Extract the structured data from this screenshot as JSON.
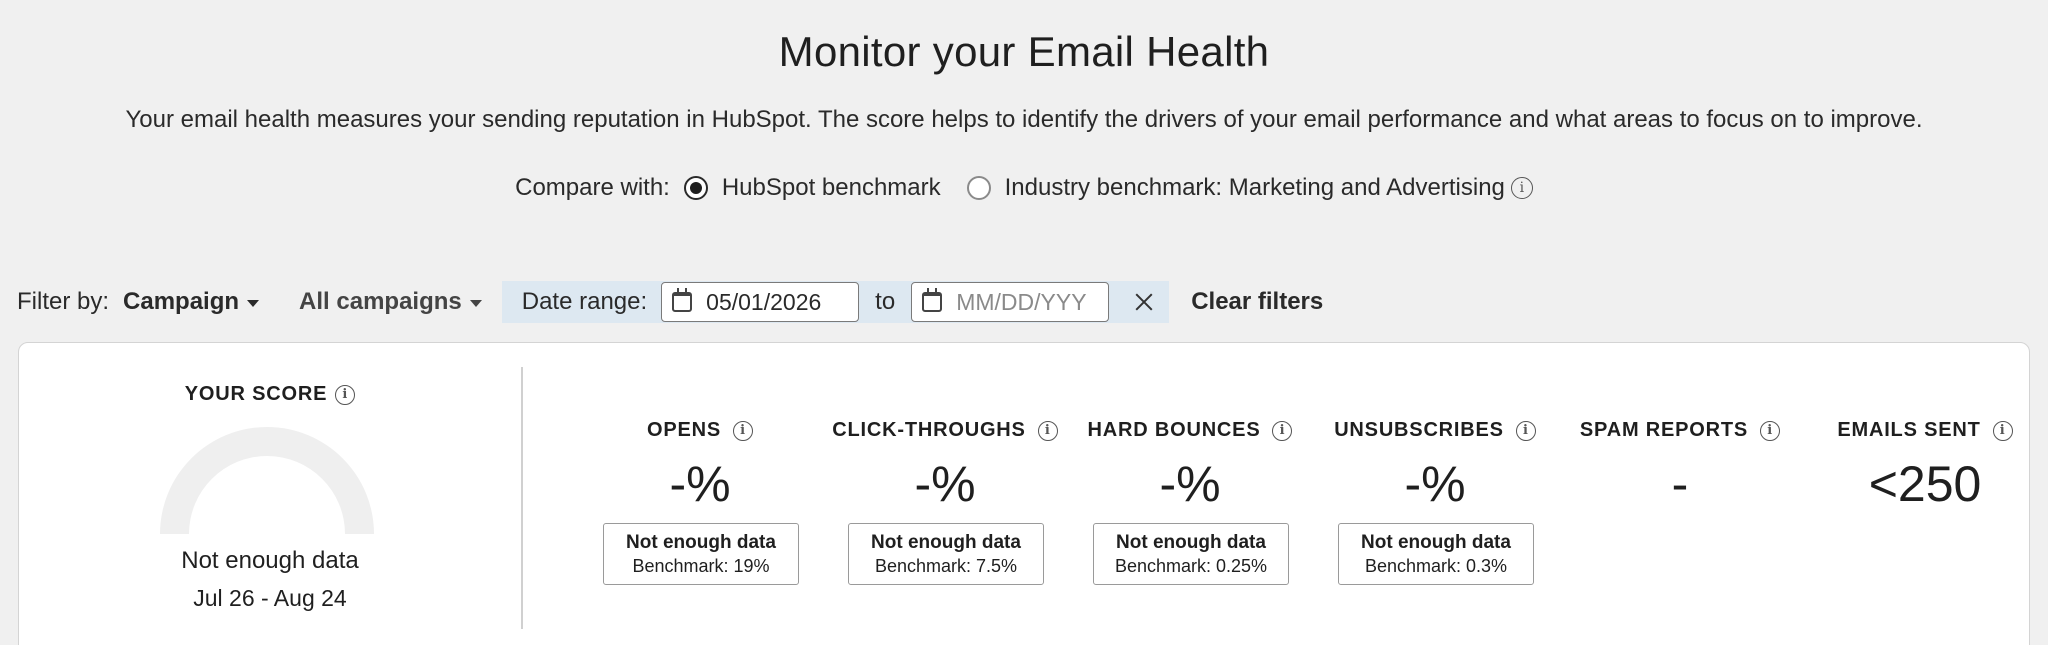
{
  "header": {
    "title": "Monitor your Email Health",
    "description": "Your email health measures your sending reputation in HubSpot. The score helps to identify the drivers of your email performance and what areas to focus on to improve."
  },
  "compare": {
    "label": "Compare with:",
    "options": [
      {
        "label": "HubSpot benchmark",
        "selected": true
      },
      {
        "label": "Industry benchmark: Marketing and Advertising",
        "selected": false
      }
    ]
  },
  "filters": {
    "label": "Filter by:",
    "type_dropdown": "Campaign",
    "value_dropdown": "All campaigns",
    "date_range_label": "Date range:",
    "start_date": "05/01/2026",
    "to_label": "to",
    "end_date_placeholder": "MM/DD/YYY",
    "clear_label": "Clear filters"
  },
  "score": {
    "title": "YOUR SCORE",
    "status": "Not enough data",
    "dates": "Jul 26 - Aug 24"
  },
  "metrics": [
    {
      "title": "OPENS",
      "value": "-%",
      "status": "Not enough data",
      "benchmark": "Benchmark: 19%"
    },
    {
      "title": "CLICK-THROUGHS",
      "value": "-%",
      "status": "Not enough data",
      "benchmark": "Benchmark: 7.5%"
    },
    {
      "title": "HARD BOUNCES",
      "value": "-%",
      "status": "Not enough data",
      "benchmark": "Benchmark: 0.25%"
    },
    {
      "title": "UNSUBSCRIBES",
      "value": "-%",
      "status": "Not enough data",
      "benchmark": "Benchmark: 0.3%"
    },
    {
      "title": "SPAM REPORTS",
      "value": "-"
    },
    {
      "title": "EMAILS SENT",
      "value": "<250"
    }
  ],
  "icons": {
    "info": "info-icon",
    "calendar": "calendar-icon",
    "close": "close-icon",
    "caret": "chevron-down-icon"
  },
  "colors": {
    "background": "#f0f0f0",
    "date_range_bg": "#dde8f1",
    "gauge_track": "#efefef"
  }
}
